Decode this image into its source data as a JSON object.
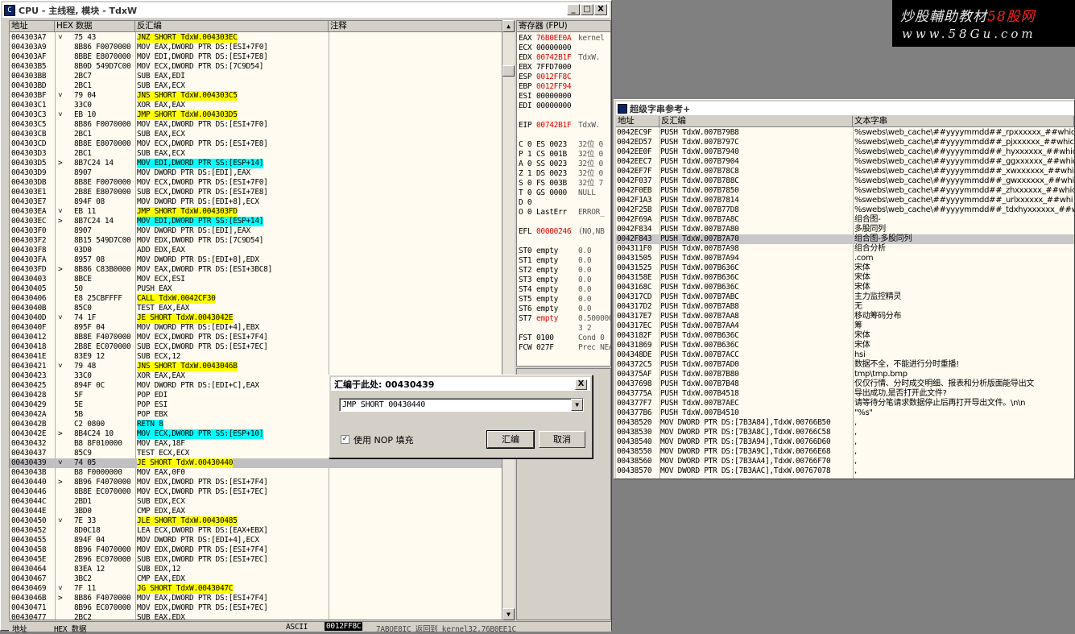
{
  "cpu_window": {
    "title": "CPU - 主线程, 模块 - TdxW",
    "min": "_",
    "max": "□",
    "close": "X",
    "col_addr": "地址",
    "col_hex": "HEX 数据",
    "col_asm": "反汇编",
    "col_comment": "注释"
  },
  "rows": [
    [
      "004303A7",
      "˅",
      "75 43",
      "JNZ SHORT TdxW.004303EC",
      "y"
    ],
    [
      "004303A9",
      "",
      "8B86 F0070000",
      "MOV EAX,DWORD PTR DS:[ESI+7F0]",
      ""
    ],
    [
      "004303AF",
      "",
      "8BBE E8070000",
      "MOV EDI,DWORD PTR DS:[ESI+7E8]",
      ""
    ],
    [
      "004303B5",
      "",
      "8B0D 549D7C00",
      "MOV ECX,DWORD PTR DS:[7C9D54]",
      ""
    ],
    [
      "004303BB",
      "",
      "2BC7",
      "SUB EAX,EDI",
      ""
    ],
    [
      "004303BD",
      "",
      "2BC1",
      "SUB EAX,ECX",
      ""
    ],
    [
      "004303BF",
      "˅",
      "79 04",
      "JNS SHORT TdxW.004303C5",
      "y"
    ],
    [
      "004303C1",
      "",
      "33C0",
      "XOR EAX,EAX",
      ""
    ],
    [
      "004303C3",
      "˅",
      "EB 10",
      "JMP SHORT TdxW.004303D5",
      "y"
    ],
    [
      "004303C5",
      "",
      "8B86 F0070000",
      "MOV EAX,DWORD PTR DS:[ESI+7F0]",
      ""
    ],
    [
      "004303CB",
      "",
      "2BC1",
      "SUB EAX,ECX",
      ""
    ],
    [
      "004303CD",
      "",
      "8B8E E8070000",
      "MOV ECX,DWORD PTR DS:[ESI+7E8]",
      ""
    ],
    [
      "004303D3",
      "",
      "2BC1",
      "SUB EAX,ECX",
      ""
    ],
    [
      "004303D5",
      "&gt;",
      "8B7C24 14",
      "MOV EDI,DWORD PTR SS:[ESP+14]",
      "c"
    ],
    [
      "004303D9",
      "",
      "8907",
      "MOV DWORD PTR DS:[EDI],EAX",
      ""
    ],
    [
      "004303DB",
      "",
      "8B8E F0070000",
      "MOV ECX,DWORD PTR DS:[ESI+7F0]",
      ""
    ],
    [
      "004303E1",
      "",
      "2B8E E8070000",
      "SUB ECX,DWORD PTR DS:[ESI+7E8]",
      ""
    ],
    [
      "004303E7",
      "",
      "894F 08",
      "MOV DWORD PTR DS:[EDI+8],ECX",
      ""
    ],
    [
      "004303EA",
      "˅",
      "EB 11",
      "JMP SHORT TdxW.004303FD",
      "y"
    ],
    [
      "004303EC",
      "&gt;",
      "8B7C24 14",
      "MOV EDI,DWORD PTR SS:[ESP+14]",
      "c"
    ],
    [
      "004303F0",
      "",
      "8907",
      "MOV DWORD PTR DS:[EDI],EAX",
      ""
    ],
    [
      "004303F2",
      "",
      "8B15 549D7C00",
      "MOV EDX,DWORD PTR DS:[7C9D54]",
      ""
    ],
    [
      "004303F8",
      "",
      "03D0",
      "ADD EDX,EAX",
      ""
    ],
    [
      "004303FA",
      "",
      "8957 08",
      "MOV DWORD PTR DS:[EDI+8],EDX",
      ""
    ],
    [
      "004303FD",
      "&gt;",
      "8B86 C83B0000",
      "MOV EAX,DWORD PTR DS:[ESI+3BC8]",
      ""
    ],
    [
      "00430403",
      "",
      "8BCE",
      "MOV ECX,ESI",
      ""
    ],
    [
      "00430405",
      "",
      "50",
      "PUSH EAX",
      ""
    ],
    [
      "00430406",
      "",
      "E8 25CBFFFF",
      "CALL TdxW.0042CF30",
      "y"
    ],
    [
      "0043040B",
      "",
      "85C0",
      "TEST EAX,EAX",
      ""
    ],
    [
      "0043040D",
      "˅",
      "74 1F",
      "JE SHORT TdxW.0043042E",
      "y"
    ],
    [
      "0043040F",
      "",
      "895F 04",
      "MOV DWORD PTR DS:[EDI+4],EBX",
      ""
    ],
    [
      "00430412",
      "",
      "8B8E F4070000",
      "MOV ECX,DWORD PTR DS:[ESI+7F4]",
      ""
    ],
    [
      "00430418",
      "",
      "2B8E EC070000",
      "SUB ECX,DWORD PTR DS:[ESI+7EC]",
      ""
    ],
    [
      "0043041E",
      "",
      "83E9 12",
      "SUB ECX,12",
      ""
    ],
    [
      "00430421",
      "˅",
      "79 48",
      "JNS SHORT TdxW.0043046B",
      "y"
    ],
    [
      "00430423",
      "",
      "33C0",
      "XOR EAX,EAX",
      ""
    ],
    [
      "00430425",
      "",
      "894F 0C",
      "MOV DWORD PTR DS:[EDI+C],EAX",
      ""
    ],
    [
      "00430428",
      "",
      "5F",
      "POP EDI",
      ""
    ],
    [
      "00430429",
      "",
      "5E",
      "POP ESI",
      ""
    ],
    [
      "0043042A",
      "",
      "5B",
      "POP EBX",
      ""
    ],
    [
      "0043042B",
      "",
      "C2 0800",
      "RETN 8",
      "c"
    ],
    [
      "0043042E",
      "&gt;",
      "8B4C24 10",
      "MOV ECX,DWORD PTR SS:[ESP+10]",
      "c"
    ],
    [
      "00430432",
      "",
      "B8 8F010000",
      "MOV EAX,18F",
      ""
    ],
    [
      "00430437",
      "",
      "85C9",
      "TEST ECX,ECX",
      ""
    ],
    [
      "00430439",
      "˅",
      "74 05",
      "JE SHORT TdxW.00430440",
      "ys"
    ],
    [
      "0043043B",
      "",
      "B8 F0000000",
      "MOV EAX,0F0",
      ""
    ],
    [
      "00430440",
      "&gt;",
      "8B96 F4070000",
      "MOV EDX,DWORD PTR DS:[ESI+7F4]",
      ""
    ],
    [
      "00430446",
      "",
      "8B8E EC070000",
      "MOV ECX,DWORD PTR DS:[ESI+7EC]",
      ""
    ],
    [
      "0043044C",
      "",
      "2BD1",
      "SUB EDX,ECX",
      ""
    ],
    [
      "0043044E",
      "",
      "3BD0",
      "CMP EDX,EAX",
      ""
    ],
    [
      "00430450",
      "˅",
      "7E 33",
      "JLE SHORT TdxW.00430485",
      "y"
    ],
    [
      "00430452",
      "",
      "8D0C18",
      "LEA ECX,DWORD PTR DS:[EAX+EBX]",
      ""
    ],
    [
      "00430455",
      "",
      "894F 04",
      "MOV DWORD PTR DS:[EDI+4],ECX",
      ""
    ],
    [
      "00430458",
      "",
      "8B96 F4070000",
      "MOV EDX,DWORD PTR DS:[ESI+7F4]",
      ""
    ],
    [
      "0043045E",
      "",
      "2B96 EC070000",
      "SUB EDX,DWORD PTR DS:[ESI+7EC]",
      ""
    ],
    [
      "00430464",
      "",
      "83EA 12",
      "SUB EDX,12",
      ""
    ],
    [
      "00430467",
      "",
      "3BC2",
      "CMP EAX,EDX",
      ""
    ],
    [
      "00430469",
      "˅",
      "7F 11",
      "JG SHORT TdxW.0043047C",
      "y"
    ],
    [
      "0043046B",
      "&gt;",
      "8B86 F4070000",
      "MOV EAX,DWORD PTR DS:[ESI+7F4]",
      ""
    ],
    [
      "00430471",
      "",
      "8B96 EC070000",
      "MOV EDX,DWORD PTR DS:[ESI+7EC]",
      ""
    ],
    [
      "00430477",
      "",
      "2BC2",
      "SUB EAX,EDX",
      ""
    ]
  ],
  "regs": {
    "header": "寄存器 (FPU)",
    "lines": [
      [
        "EAX",
        "76B0EE0A",
        "kernel",
        "r"
      ],
      [
        "ECX",
        "00000000",
        "",
        ""
      ],
      [
        "EDX",
        "00742B1F",
        "TdxW.",
        "r"
      ],
      [
        "EBX",
        "7FFD7000",
        "",
        ""
      ],
      [
        "ESP",
        "0012FF8C",
        "",
        "r"
      ],
      [
        "EBP",
        "0012FF94",
        "",
        "r"
      ],
      [
        "ESI",
        "00000000",
        "",
        ""
      ],
      [
        "EDI",
        "00000000",
        "",
        ""
      ],
      [
        "",
        "",
        "",
        ""
      ],
      [
        "EIP",
        "00742B1F",
        "TdxW.",
        "r"
      ],
      [
        "",
        "",
        "",
        ""
      ],
      [
        "C 0",
        "ES 0023",
        "32位 0",
        ""
      ],
      [
        "P 1",
        "CS 001B",
        "32位 0",
        ""
      ],
      [
        "A 0",
        "SS 0023",
        "32位 0",
        ""
      ],
      [
        "Z 1",
        "DS 0023",
        "32位 0",
        ""
      ],
      [
        "S 0",
        "FS 003B",
        "32位 7",
        ""
      ],
      [
        "T 0",
        "GS 0000",
        "NULL",
        ""
      ],
      [
        "D 0",
        "",
        "",
        ""
      ],
      [
        "O 0",
        "LastErr",
        "ERROR_",
        ""
      ],
      [
        "",
        "",
        "",
        ""
      ],
      [
        "EFL",
        "00000246",
        "(NO,NB",
        "r"
      ],
      [
        "",
        "",
        "",
        ""
      ],
      [
        "ST0",
        "empty",
        "0.0",
        ""
      ],
      [
        "ST1",
        "empty",
        "0.0",
        ""
      ],
      [
        "ST2",
        "empty",
        "0.0",
        ""
      ],
      [
        "ST3",
        "empty",
        "0.0",
        ""
      ],
      [
        "ST4",
        "empty",
        "0.0",
        ""
      ],
      [
        "ST5",
        "empty",
        "0.0",
        ""
      ],
      [
        "ST6",
        "empty",
        "0.0",
        ""
      ],
      [
        "ST7",
        "empty",
        "0.5000000",
        "r"
      ],
      [
        "",
        "",
        "3 2",
        ""
      ],
      [
        "FST",
        "0100",
        "Cond 0",
        ""
      ],
      [
        "FCW",
        "027F",
        "Prec NEAR",
        ""
      ]
    ]
  },
  "dialog": {
    "title": "汇编于此处: 00430439",
    "close": "X",
    "combo_value": "JMP SHORT 00430440",
    "check_mark": "✓",
    "check_label": "使用 NOP 填充",
    "ok": "汇编",
    "cancel": "取消"
  },
  "watermark": {
    "line1_a": "炒股輔助教材",
    "line1_b": "58股网",
    "line2": "www.58Gu.com"
  },
  "strings_window": {
    "title": "超级字串参考+",
    "col_addr": "地址",
    "col_asm": "反汇编",
    "col_text": "文本字串",
    "rows": [
      [
        "0042EC9F",
        "PUSH TdxW.007B79B8",
        "%swebs\\web_cache\\##yyyymmdd##_rpxxxxxx_##whic"
      ],
      [
        "0042ED57",
        "PUSH TdxW.007B797C",
        "%swebs\\web_cache\\##yyyymmdd##_pjxxxxxx_##whic"
      ],
      [
        "0042EE0F",
        "PUSH TdxW.007B7940",
        "%swebs\\web_cache\\##yyyymmdd##_hyxxxxxx_##whic"
      ],
      [
        "0042EEC7",
        "PUSH TdxW.007B7904",
        "%swebs\\web_cache\\##yyyymmdd##_ggxxxxxx_##whic"
      ],
      [
        "0042EF7F",
        "PUSH TdxW.007B78C8",
        "%swebs\\web_cache\\##yyyymmdd##_xwxxxxxx_##whic"
      ],
      [
        "0042F037",
        "PUSH TdxW.007B788C",
        "%swebs\\web_cache\\##yyyymmdd##_gwxxxxxx_##whic"
      ],
      [
        "0042F0EB",
        "PUSH TdxW.007B7850",
        "%swebs\\web_cache\\##yyyymmdd##_zhxxxxxx_##whic"
      ],
      [
        "0042F1A3",
        "PUSH TdxW.007B7814",
        "%swebs\\web_cache\\##yyyymmdd##_urlxxxxxx_##whi"
      ],
      [
        "0042F25B",
        "PUSH TdxW.007B77D8",
        "%swebs\\web_cache\\##yyyymmdd##_tdxhyxxxxxx_##wh"
      ],
      [
        "0042F69A",
        "PUSH TdxW.007B7A8C",
        "组合图-"
      ],
      [
        "0042F834",
        "PUSH TdxW.007B7A80",
        "多股同列"
      ],
      [
        "0042F843",
        "PUSH TdxW.007B7A70",
        "组合图-多股同列"
      ],
      [
        "004311F0",
        "PUSH TdxW.007B7A98",
        "组合分析"
      ],
      [
        "00431505",
        "PUSH TdxW.007B7A94",
        ".com"
      ],
      [
        "00431525",
        "PUSH TdxW.007B636C",
        "宋体"
      ],
      [
        "0043158E",
        "PUSH TdxW.007B636C",
        "宋体"
      ],
      [
        "0043168C",
        "PUSH TdxW.007B636C",
        "宋体"
      ],
      [
        "004317CD",
        "PUSH TdxW.007B7ABC",
        "主力监控精灵"
      ],
      [
        "004317D2",
        "PUSH TdxW.007B7AB8",
        "无"
      ],
      [
        "004317E7",
        "PUSH TdxW.007B7AA8",
        "移动筹码分布"
      ],
      [
        "004317EC",
        "PUSH TdxW.007B7AA4",
        "筹"
      ],
      [
        "0043182F",
        "PUSH TdxW.007B636C",
        "宋体"
      ],
      [
        "00431869",
        "PUSH TdxW.007B636C",
        "宋体"
      ],
      [
        "004348DE",
        "PUSH TdxW.007B7ACC",
        "hsi"
      ],
      [
        "004372C5",
        "PUSH TdxW.007B7AD0",
        "数据不全，不能进行分时重播!"
      ],
      [
        "004375AF",
        "PUSH TdxW.007B7B80",
        "tmp\\tmp.bmp"
      ],
      [
        "00437698",
        "PUSH TdxW.007B7B48",
        "仅仅行情、分时成交明细、报表和分析版面能导出文"
      ],
      [
        "0043775A",
        "PUSH TdxW.007B4518",
        "导出成功,是否打开此文件?"
      ],
      [
        "004377F7",
        "PUSH TdxW.007B7AEC",
        "请等待分笔请求数据停止后再打开导出文件。\\n\\n"
      ],
      [
        "004377B6",
        "PUSH TdxW.007B4510",
        "\"%s\""
      ],
      [
        "00438520",
        "MOV DWORD PTR DS:[7B3A84],TdxW.00766B50",
        ","
      ],
      [
        "00438530",
        "MOV DWORD PTR DS:[7B3A8C],TdxW.00766C58",
        ","
      ],
      [
        "00438540",
        "MOV DWORD PTR DS:[7B3A94],TdxW.00766D60",
        ","
      ],
      [
        "00438550",
        "MOV DWORD PTR DS:[7B3A9C],TdxW.00766E68",
        ","
      ],
      [
        "00438560",
        "MOV DWORD PTR DS:[7B3AA4],TdxW.00766F70",
        ","
      ],
      [
        "00438570",
        "MOV DWORD PTR DS:[7B3AAC],TdxW.00767078",
        ","
      ]
    ],
    "selected_index": 11
  },
  "bottom": {
    "addr": "地址",
    "hex": "HEX 数据",
    "ascii": "ASCII",
    "addr2": "0012FF8C",
    "extra": "7ABOE8IC 返回到 kernel32.76B0EE1C"
  }
}
